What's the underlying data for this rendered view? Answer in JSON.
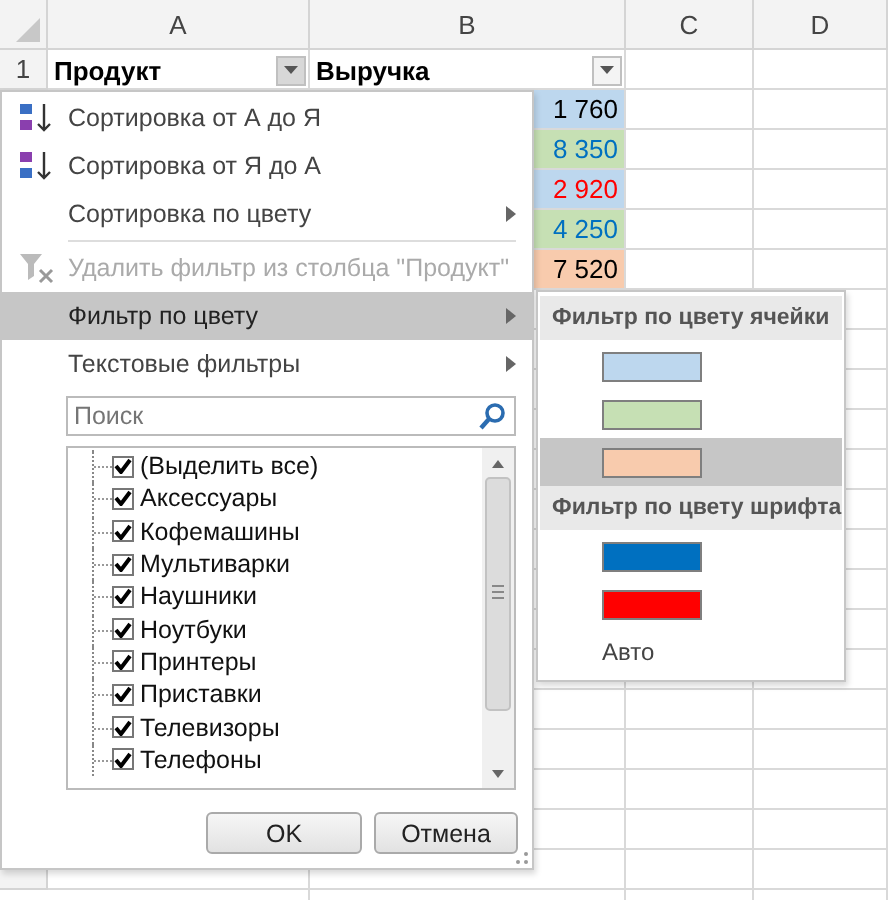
{
  "sheet": {
    "columns": [
      {
        "label": "A"
      },
      {
        "label": "B"
      },
      {
        "label": "C"
      },
      {
        "label": "D"
      }
    ],
    "row_number": "1",
    "headers": [
      {
        "text": "Продукт",
        "filter_open": true
      },
      {
        "text": "Выручка",
        "filter_open": false
      }
    ],
    "values": [
      {
        "text": "1 760",
        "color": "#bdd7ee",
        "kind": "plain"
      },
      {
        "text": "8 350",
        "color": "#c6e0b4",
        "kind": "blue-font"
      },
      {
        "text": "2 920",
        "color": "#bdd7ee",
        "kind": "red-font"
      },
      {
        "text": "4 250",
        "color": "#c6e0b4",
        "kind": "blue-font"
      },
      {
        "text": "7 520",
        "color": "#f8cbad",
        "kind": "plain"
      }
    ]
  },
  "filter_menu": {
    "items": [
      {
        "kind": "sort-az",
        "label": "Сортировка от А до Я",
        "submenu": false,
        "disabled": false,
        "selected": false
      },
      {
        "kind": "sort-za",
        "label": "Сортировка от Я до А",
        "submenu": false,
        "disabled": false,
        "selected": false
      },
      {
        "kind": "plain",
        "label": "Сортировка по цвету",
        "submenu": true,
        "disabled": false,
        "selected": false
      },
      {
        "kind": "separator"
      },
      {
        "kind": "clear-filter",
        "label": "Удалить фильтр из столбца \"Продукт\"",
        "submenu": false,
        "disabled": true,
        "selected": false
      },
      {
        "kind": "plain",
        "label": "Фильтр по цвету",
        "submenu": true,
        "disabled": false,
        "selected": true
      },
      {
        "kind": "plain",
        "label": "Текстовые фильтры",
        "submenu": true,
        "disabled": false,
        "selected": false
      }
    ],
    "search": {
      "placeholder": "Поиск"
    },
    "list": [
      {
        "label": "(Выделить все)",
        "checked": true
      },
      {
        "label": "Аксессуары",
        "checked": true
      },
      {
        "label": "Кофемашины",
        "checked": true
      },
      {
        "label": "Мультиварки",
        "checked": true
      },
      {
        "label": "Наушники",
        "checked": true
      },
      {
        "label": "Ноутбуки",
        "checked": true
      },
      {
        "label": "Принтеры",
        "checked": true
      },
      {
        "label": "Приставки",
        "checked": true
      },
      {
        "label": "Телевизоры",
        "checked": true
      },
      {
        "label": "Телефоны",
        "checked": true
      }
    ],
    "buttons": [
      "OK",
      "Отмена"
    ]
  },
  "color_submenu": {
    "sections": [
      {
        "title": "Фильтр по цвету ячейки",
        "swatches": [
          {
            "color": "#bdd7ee",
            "selected": false
          },
          {
            "color": "#c6e0b4",
            "selected": false
          },
          {
            "color": "#f8cbad",
            "selected": true
          }
        ]
      },
      {
        "title": "Фильтр по цвету шрифта",
        "swatches": [
          {
            "color": "#0070c0",
            "selected": false
          },
          {
            "color": "#ff0000",
            "selected": false
          }
        ]
      }
    ],
    "auto": "Авто"
  }
}
